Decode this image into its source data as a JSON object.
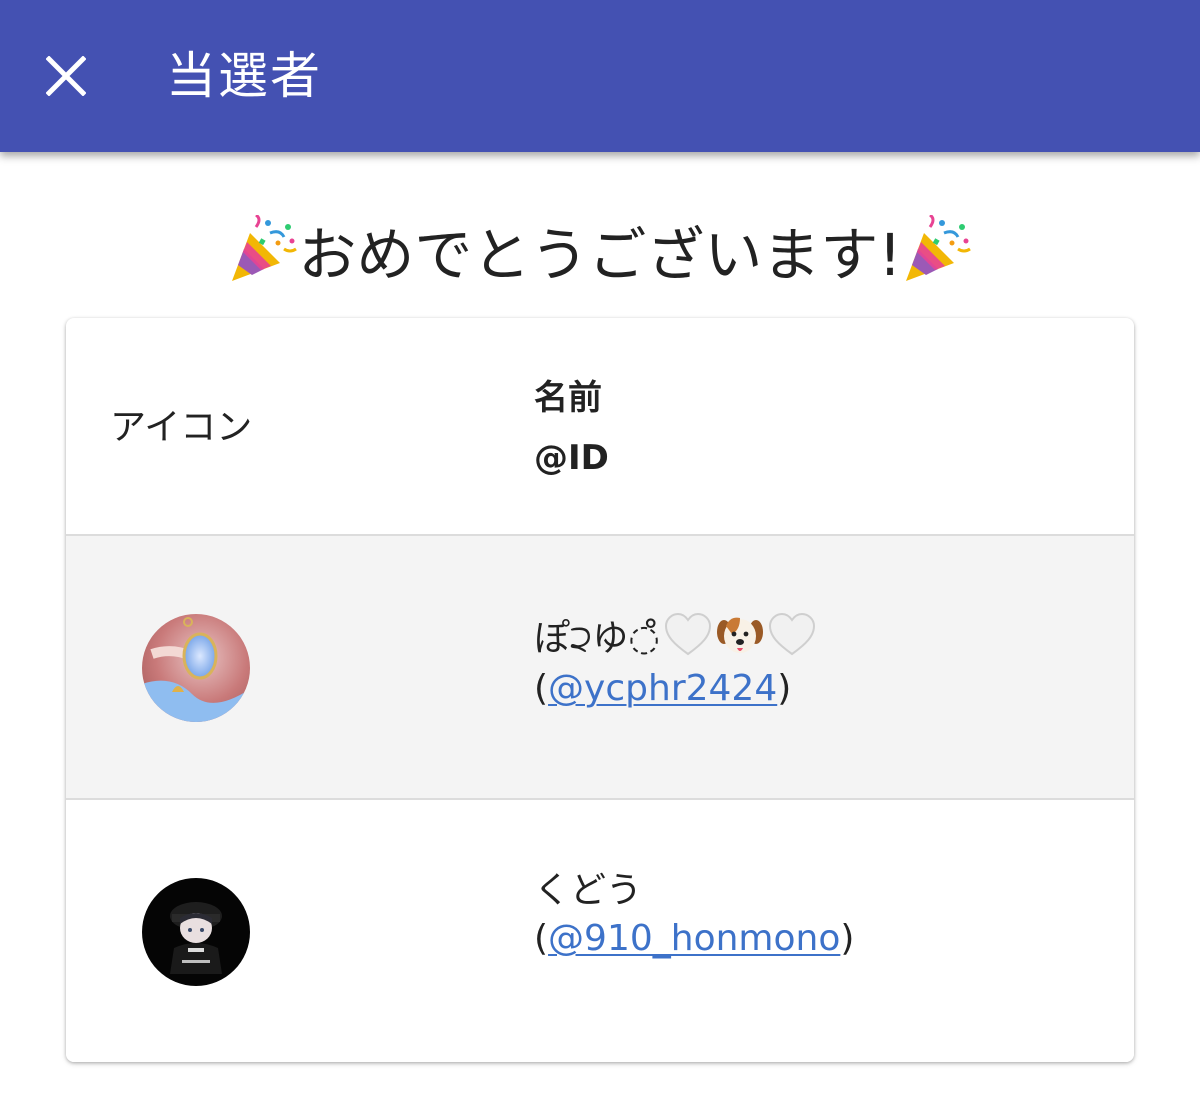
{
  "app_bar": {
    "title": "当選者",
    "close_icon": "close-icon",
    "color": "#4451b2"
  },
  "congrats": {
    "text": "おめでとうございます!",
    "left_icon": "party-popper-icon",
    "right_icon": "party-popper-icon"
  },
  "table": {
    "headers": {
      "icon": "アイコン",
      "name": "名前",
      "id": "@ID"
    },
    "rows": [
      {
        "avatar": "avatar-image",
        "name": "ぽ੨ゆ◌̊",
        "name_emoji": [
          "white-heart-icon",
          "dog-face-icon",
          "white-heart-icon"
        ],
        "handle_open": "(",
        "handle": "@ycphr2424",
        "handle_close": ")"
      },
      {
        "avatar": "avatar-image",
        "name": "くどう",
        "name_emoji": [],
        "handle_open": "(",
        "handle": "@910_honmono",
        "handle_close": ")"
      }
    ]
  },
  "colors": {
    "link": "#3d72c9",
    "row_highlight": "#f4f4f4"
  }
}
